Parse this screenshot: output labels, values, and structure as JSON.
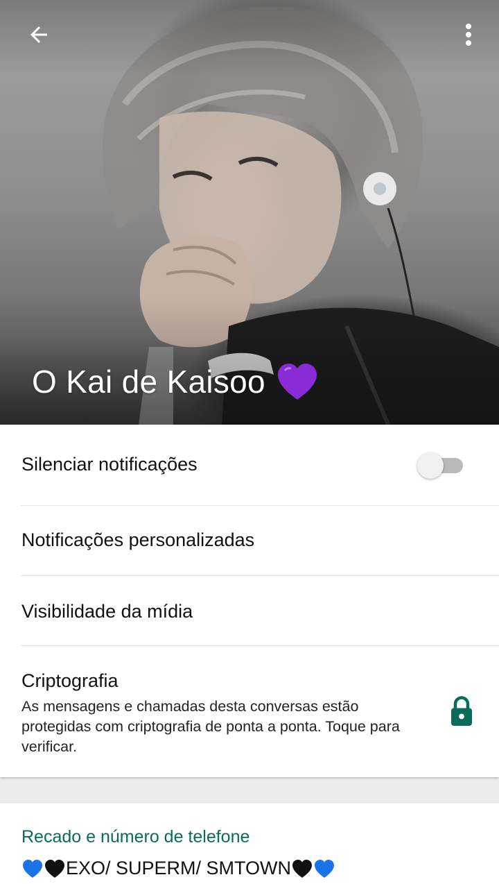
{
  "header": {
    "back_icon": "arrow-left-icon",
    "menu_icon": "more-vert-icon",
    "contact_name": "O Kai de Kaisoo",
    "name_emoji": "purple-heart"
  },
  "settings": {
    "mute_label": "Silenciar notificações",
    "mute_enabled": false,
    "custom_notifications_label": "Notificações personalizadas",
    "media_visibility_label": "Visibilidade da mídia",
    "encryption_title": "Criptografia",
    "encryption_description": "As mensagens e chamadas desta conversas estão protegidas com criptografia de ponta a ponta. Toque para verificar.",
    "encryption_icon": "lock-icon"
  },
  "about": {
    "title": "Recado e número de telefone",
    "status_text": "EXO/ SUPERM/ SMTOWN"
  },
  "colors": {
    "accent": "#0b6b5a",
    "lock": "#0b6b5a",
    "purple_heart": "#8a2bd8",
    "blue_heart": "#1a73e8",
    "black_heart": "#111111"
  }
}
